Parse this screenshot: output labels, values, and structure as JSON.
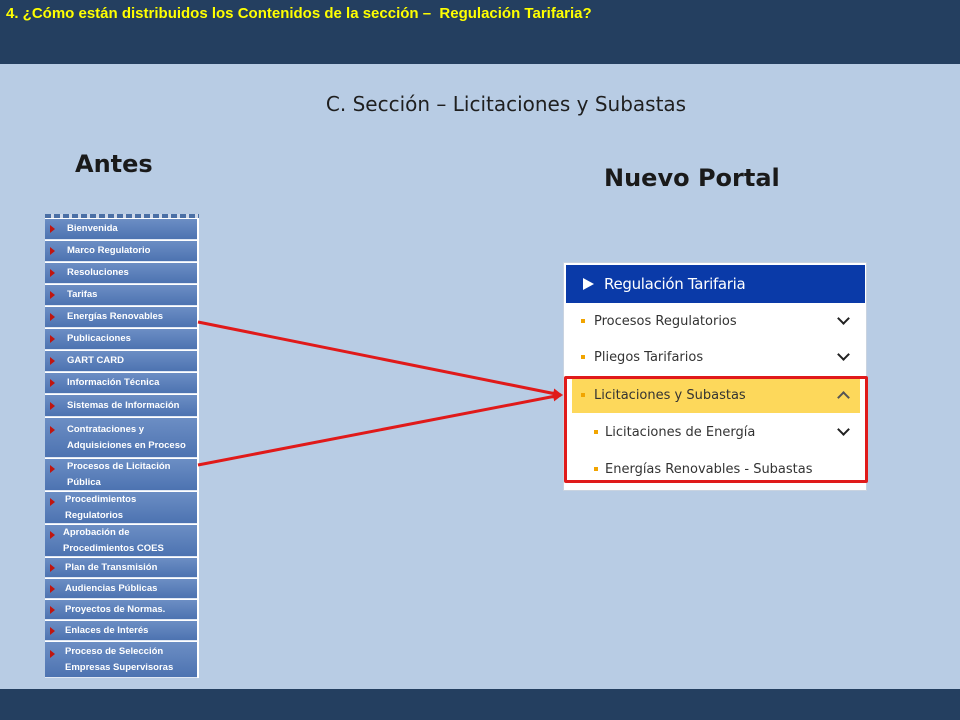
{
  "header": {
    "title": "4. ¿Cómo están distribuidos los Contenidos de la sección –  Regulación Tarifaria?"
  },
  "section_title": "C. Sección – Licitaciones y Subastas",
  "labels": {
    "before": "Antes",
    "new_portal": "Nuevo Portal"
  },
  "old_menu": {
    "items": [
      {
        "label": "Bienvenida"
      },
      {
        "label": "Marco Regulatorio"
      },
      {
        "label": "Resoluciones"
      },
      {
        "label": "Tarifas"
      },
      {
        "label": "Energías Renovables"
      },
      {
        "label": "Publicaciones"
      },
      {
        "label": "GART CARD"
      },
      {
        "label": "Información Técnica"
      },
      {
        "label": "Sistemas de Información"
      },
      {
        "label": "Contrataciones y\nAdquisiciones en Proceso"
      },
      {
        "label": "Procesos de Licitación\nPública"
      },
      {
        "label": "Procedimientos\nRegulatorios"
      },
      {
        "label": "Aprobación de\nProcedimientos COES"
      },
      {
        "label": "Plan de Transmisión"
      },
      {
        "label": "Audiencias Públicas"
      },
      {
        "label": "Proyectos de Normas."
      },
      {
        "label": "Enlaces de Interés"
      },
      {
        "label": "Proceso de Selección\nEmpresas Supervisoras"
      }
    ]
  },
  "new_portal": {
    "header": "Regulación Tarifaria",
    "items": [
      {
        "label": "Procesos Regulatorios",
        "level": 1,
        "expand": "down"
      },
      {
        "label": "Pliegos Tarifarios",
        "level": 1,
        "expand": "down"
      },
      {
        "label": "Licitaciones y Subastas",
        "level": 1,
        "expand": "up",
        "active": true
      },
      {
        "label": "Licitaciones de Energía",
        "level": 2,
        "expand": "down"
      },
      {
        "label": "Energías Renovables - Subastas",
        "level": 2,
        "expand": "none"
      }
    ]
  },
  "colors": {
    "top_bar": "#243f60",
    "title_text": "#ffff00",
    "background": "#b8cce4",
    "portal_header": "#0a3aa8",
    "highlight": "#fdd85b",
    "arrow": "#e01a1a"
  }
}
